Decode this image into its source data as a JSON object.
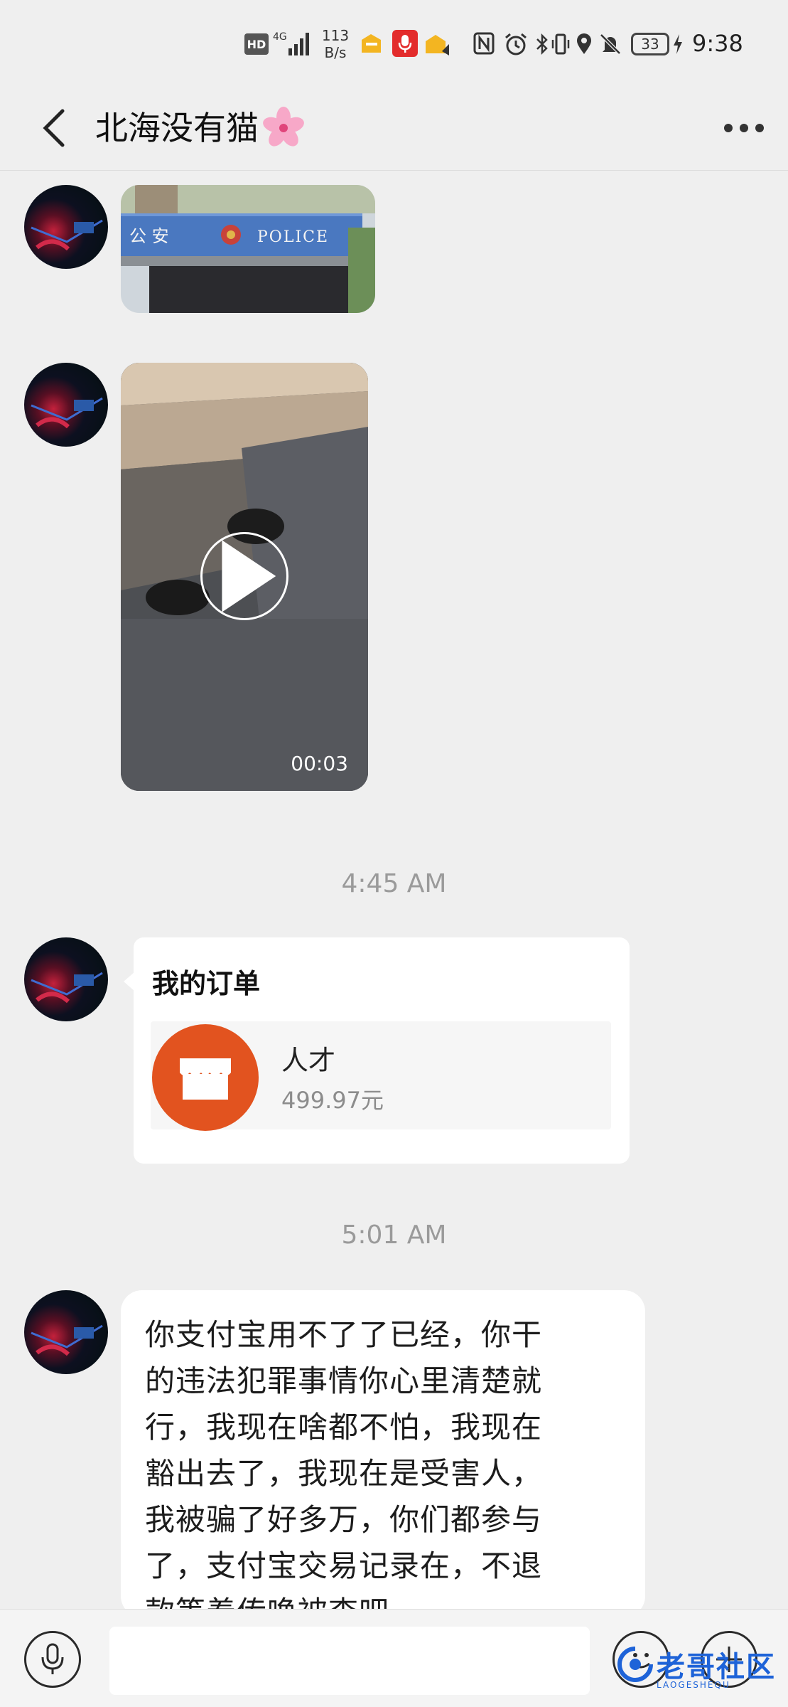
{
  "status_bar": {
    "hd": "HD",
    "network": "4G",
    "speed_value": "113",
    "speed_unit": "B/s",
    "battery": "33",
    "time": "9:38"
  },
  "header": {
    "title": "北海没有猫"
  },
  "messages": {
    "image1": {
      "sign_text": "公 安",
      "sign_police": "POLICE"
    },
    "video": {
      "duration": "00:03"
    },
    "timestamp1": "4:45 AM",
    "order": {
      "title": "我的订单",
      "item_name": "人才",
      "item_price": "499.97元"
    },
    "timestamp2": "5:01 AM",
    "text": "你支付宝用不了了已经，你干\n的违法犯罪事情你心里清楚就\n行，我现在啥都不怕，我现在\n豁出去了，我现在是受害人，\n我被骗了好多万，你们都参与\n了，支付宝交易记录在，不退\n款等着传唤被查吧"
  },
  "input_bar": {
    "placeholder": ""
  },
  "watermark": {
    "text": "老哥社区",
    "sub": "LAOGESHEQU"
  },
  "colors": {
    "background": "#efefef",
    "order_icon": "#e2531f",
    "mic": "#e32c2c",
    "watermark": "#1e63d8"
  }
}
